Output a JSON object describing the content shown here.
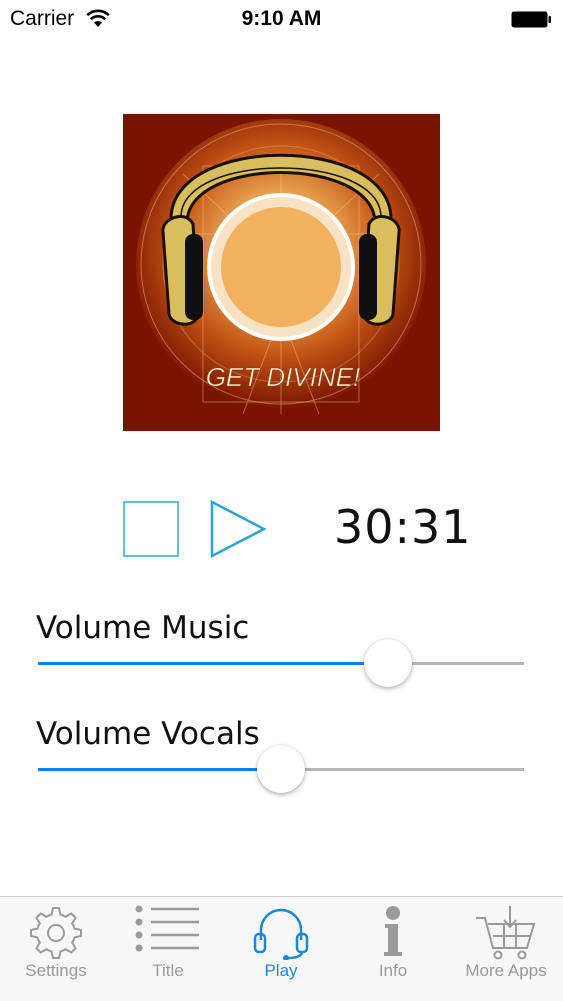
{
  "status_bar": {
    "carrier": "Carrier",
    "time": "9:10 AM"
  },
  "album": {
    "caption": "GET DIVINE!",
    "background_color": "#7a1400",
    "accent_color": "#f3b15f"
  },
  "player": {
    "elapsed": "30:31",
    "stop_icon": "stop-icon",
    "play_icon": "play-icon",
    "control_color": "#5bc1da"
  },
  "sliders": [
    {
      "label": "Volume Music",
      "value": 0.72
    },
    {
      "label": "Volume Vocals",
      "value": 0.5
    }
  ],
  "tab_bar": {
    "active_color": "#1f86d6",
    "inactive_color": "#9a9a9a",
    "tabs": [
      {
        "label": "Settings",
        "icon": "gear-icon",
        "active": false
      },
      {
        "label": "Title",
        "icon": "list-icon",
        "active": false
      },
      {
        "label": "Play",
        "icon": "headphones-icon",
        "active": true
      },
      {
        "label": "Info",
        "icon": "info-icon",
        "active": false
      },
      {
        "label": "More Apps",
        "icon": "cart-icon",
        "active": false
      }
    ]
  }
}
